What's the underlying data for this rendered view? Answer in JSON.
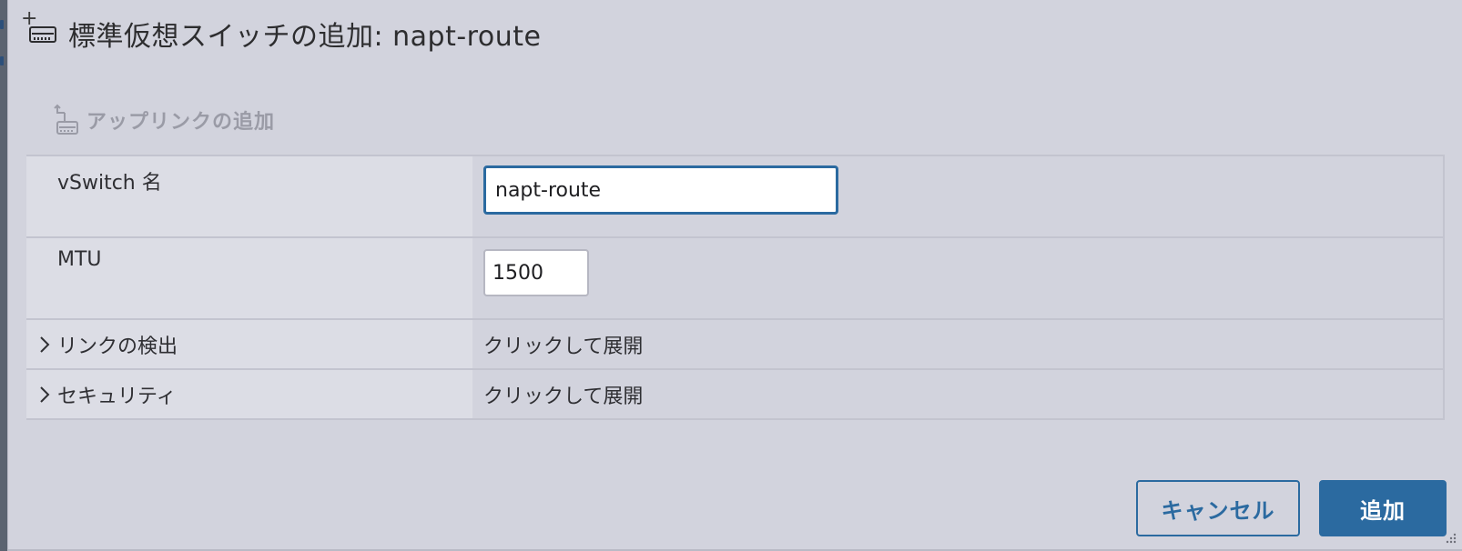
{
  "dialog": {
    "title": "標準仮想スイッチの追加: napt-route",
    "uplink_action": "アップリンクの追加"
  },
  "form": {
    "vswitch_name": {
      "label": "vSwitch 名",
      "value": "napt-route"
    },
    "mtu": {
      "label": "MTU",
      "value": "1500"
    },
    "link_discovery": {
      "label": "リンクの検出",
      "value": "クリックして展開"
    },
    "security": {
      "label": "セキュリティ",
      "value": "クリックして展開"
    }
  },
  "buttons": {
    "cancel": "キャンセル",
    "add": "追加"
  },
  "colors": {
    "accent": "#2b6aa0",
    "dialog_bg": "#d2d3dd",
    "label_bg": "#dcdde5"
  },
  "icons": {
    "title": "network-switch-icon",
    "uplink": "add-uplink-icon",
    "expand": "chevron-right-icon"
  }
}
